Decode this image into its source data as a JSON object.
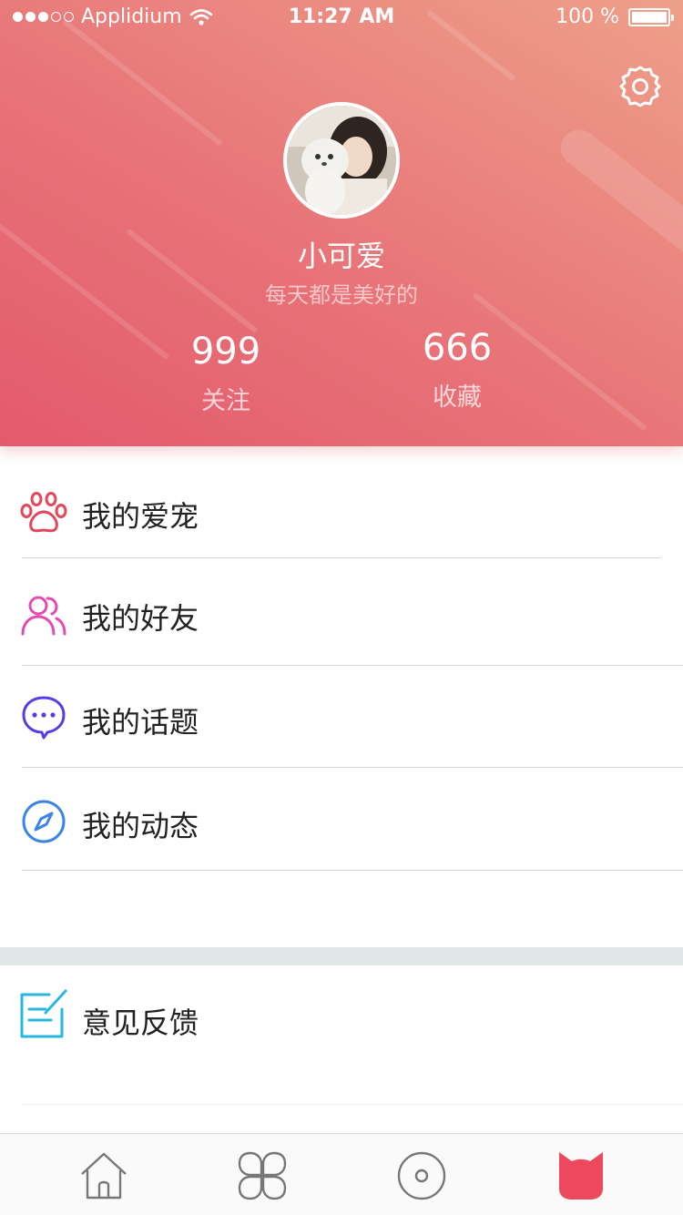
{
  "status_bar": {
    "signal": "●●●○○",
    "carrier": "Applidium",
    "time": "11:27 AM",
    "battery": "100 %",
    "icons": [
      "signal-dots-icon",
      "wifi-icon",
      "battery-icon"
    ]
  },
  "profile": {
    "name": "小可爱",
    "motto": "每天都是美好的",
    "stats": [
      {
        "value": "999",
        "label": "关注"
      },
      {
        "value": "666",
        "label": "收藏"
      }
    ],
    "settings_icon": "gear-icon"
  },
  "menu": {
    "items": [
      {
        "label": "我的爱宠",
        "icon": "paw-icon",
        "color": "#e2485c"
      },
      {
        "label": "我的好友",
        "icon": "friends-icon",
        "color": "#e44bb2"
      },
      {
        "label": "我的话题",
        "icon": "chat-bubble-icon",
        "color": "#5a3de0"
      },
      {
        "label": "我的动态",
        "icon": "compass-icon",
        "color": "#3a84e6"
      }
    ],
    "feedback": {
      "label": "意见反馈",
      "icon": "feedback-edit-icon",
      "color": "#2ab7df"
    }
  },
  "tabbar": {
    "tabs": [
      {
        "name": "home",
        "icon": "home-icon",
        "active": false
      },
      {
        "name": "categories",
        "icon": "grid-icon",
        "active": false
      },
      {
        "name": "discover",
        "icon": "disc-icon",
        "active": false
      },
      {
        "name": "mine",
        "icon": "cat-head-icon",
        "active": true
      }
    ],
    "active_color": "#ec4a5c"
  }
}
